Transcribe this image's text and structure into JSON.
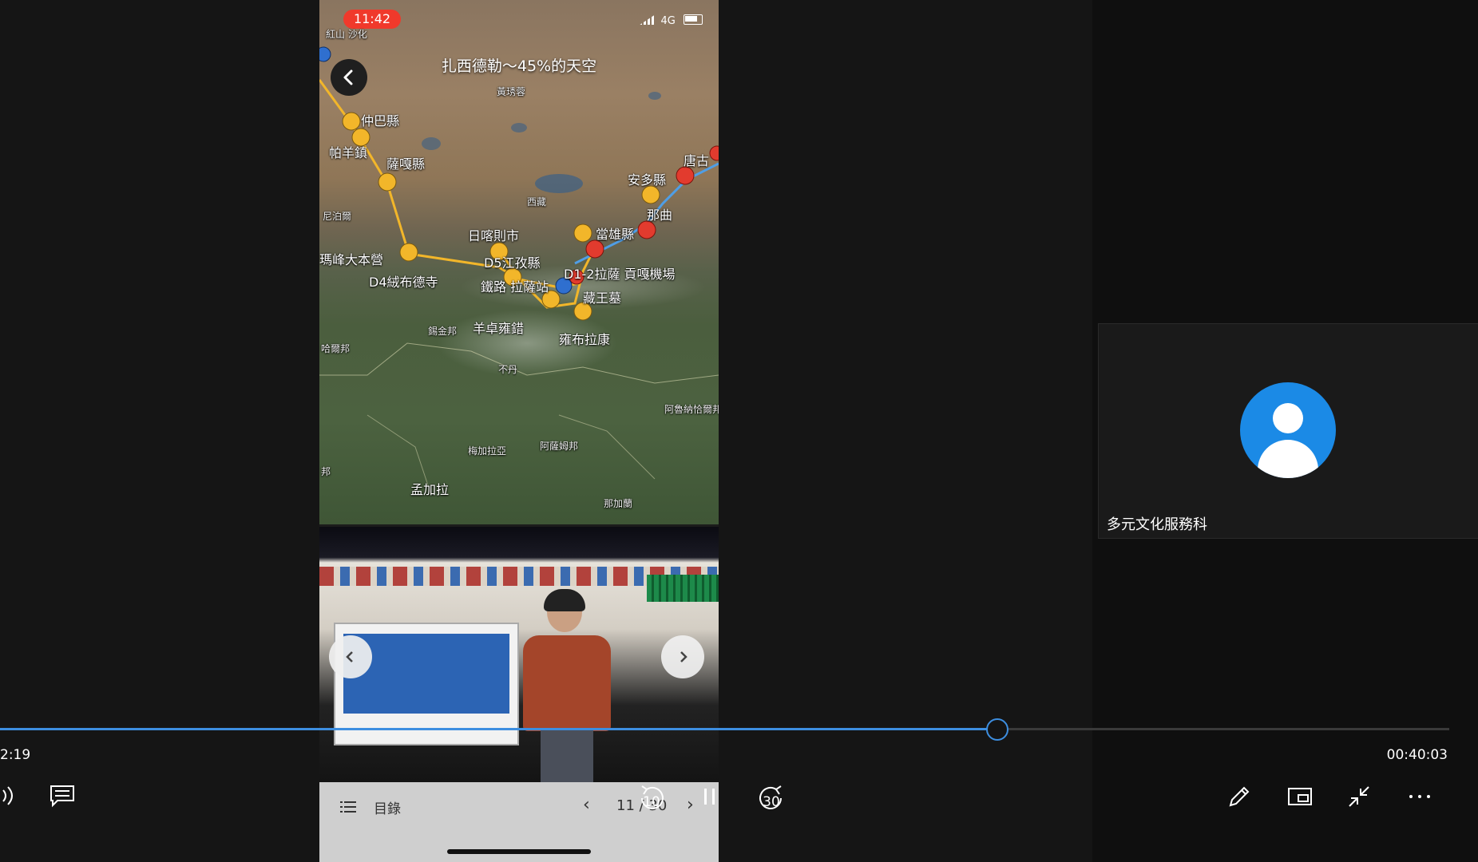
{
  "phone_status": {
    "time": "11:42",
    "network": "4G"
  },
  "map": {
    "title": "扎西德勒～45%的天空",
    "labels": [
      "紅山 沙化",
      "黃琇蓉",
      "仲巴縣",
      "帕羊鎮",
      "薩嘎縣",
      "唐古",
      "安多縣",
      "那曲",
      "西藏",
      "當雄縣",
      "日喀則市",
      "D5江孜縣",
      "瑪峰大本營",
      "D4絨布德寺",
      "鐵路 拉薩站",
      "D1-2拉薩 貢嘎機場",
      "藏王墓",
      "羊卓雍錯",
      "雍布拉康",
      "尼泊爾",
      "錫金邦",
      "不丹",
      "哈爾邦",
      "阿魯納恰爾邦",
      "梅加拉亞",
      "阿薩姆邦",
      "孟加拉",
      "邦",
      "那加蘭"
    ]
  },
  "pdf_bar": {
    "toc_label": "目錄",
    "page_indicator": "11 / 30"
  },
  "participant": {
    "name": "多元文化服務科"
  },
  "playback": {
    "elapsed": "2:19",
    "total": "00:40:03",
    "progress_fraction": 0.688,
    "rewind_seconds": "10",
    "forward_seconds": "30"
  },
  "colors": {
    "accent": "#3d8ee0",
    "avatar": "#1b8ae6",
    "status_pill": "#f0392b"
  },
  "icons": {
    "volume": "volume-icon",
    "captions": "captions-icon",
    "pen": "pen-icon",
    "pip": "picture-in-picture-icon",
    "exit_fullscreen": "exit-fullscreen-icon",
    "more": "more-icon"
  }
}
